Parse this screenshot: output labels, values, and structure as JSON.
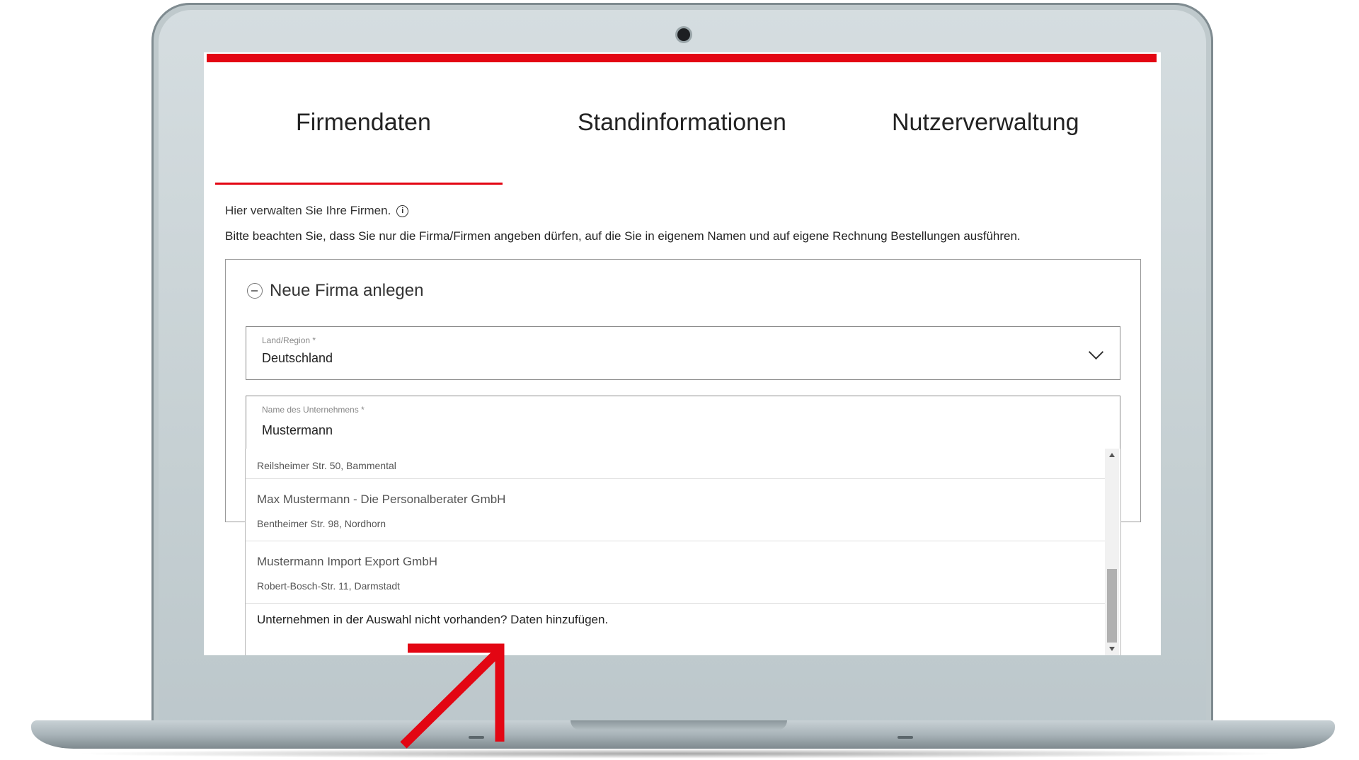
{
  "tabs": [
    {
      "label": "Firmendaten"
    },
    {
      "label": "Standinformationen"
    },
    {
      "label": "Nutzerverwaltung"
    }
  ],
  "active_tab": "Firmendaten",
  "intro_text": "Hier verwalten Sie Ihre Firmen.",
  "notice_text": "Bitte beachten Sie, dass Sie nur die Firma/Firmen angeben dürfen, auf die Sie in eigenem Namen und auf eigene Rechnung Bestellungen ausführen.",
  "card": {
    "title": "Neue Firma anlegen",
    "country_field": {
      "label": "Land/Region *",
      "value": "Deutschland"
    },
    "company_field": {
      "label": "Name des Unternehmens *",
      "value": "Mustermann"
    }
  },
  "dropdown": {
    "items": [
      {
        "name": "",
        "address": "Reilsheimer Str. 50, Bammental"
      },
      {
        "name": "Max Mustermann - Die Personalberater GmbH",
        "address": "Bentheimer Str. 98, Nordhorn"
      },
      {
        "name": "Mustermann Import Export GmbH",
        "address": "Robert-Bosch-Str. 11, Darmstadt"
      }
    ],
    "footer": "Unternehmen in der Auswahl nicht vorhanden? Daten hinzufügen."
  },
  "colors": {
    "accent": "#e30613",
    "arrow": "#e30613"
  },
  "icons": {
    "info": "info-icon",
    "collapse": "minus-circle-icon",
    "select": "chevron-down-icon"
  }
}
